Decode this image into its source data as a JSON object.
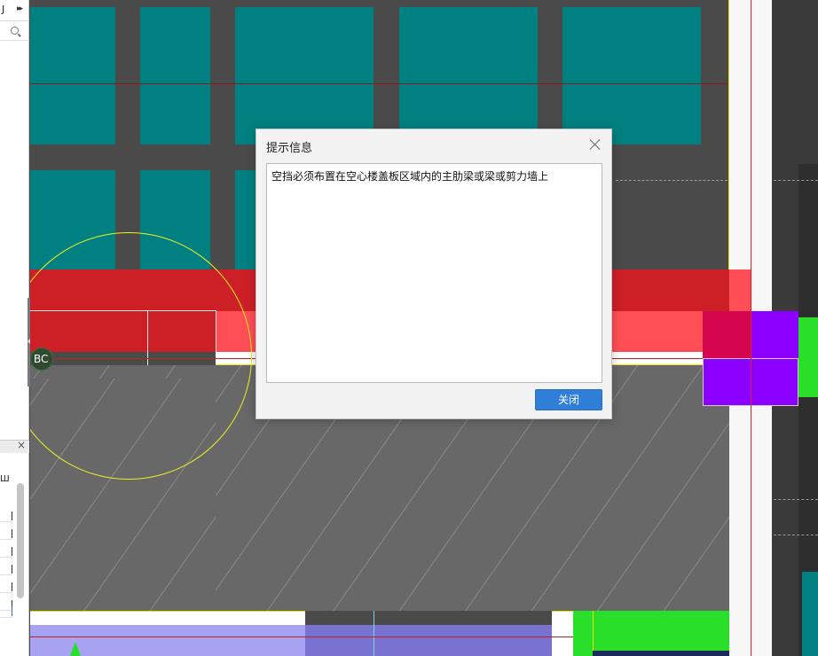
{
  "left_panel": {
    "top_glyph": "Ј",
    "expand_glyph": "▸▸",
    "search_icon": "search-icon",
    "close_glyph": "×",
    "column_glyph": "Ш"
  },
  "canvas": {
    "marker_label": "BC"
  },
  "dialog": {
    "title": "提示信息",
    "close_icon": "close-icon",
    "message": "空挡必须布置在空心楼盖板区域内的主肋梁或梁或剪力墙上",
    "close_button": "关闭"
  },
  "colors": {
    "teal_block": "#008080",
    "beam_red": "#cc1f26",
    "beam_light_red": "#ff4e56",
    "purple": "#8b00ff",
    "green": "#2adf2a",
    "lavender": "#a8a2f2",
    "hatch_gray": "#686868",
    "button_blue": "#2f7fd8"
  }
}
